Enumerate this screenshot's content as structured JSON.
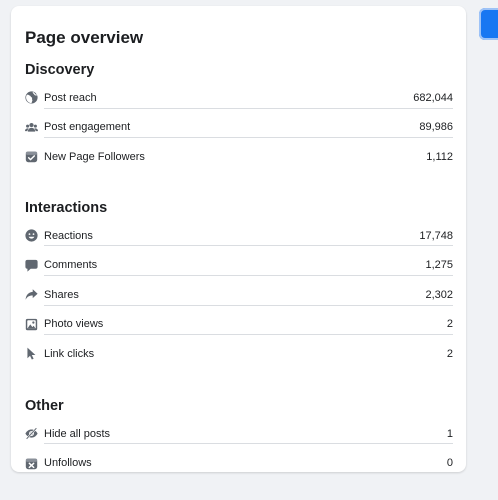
{
  "title": "Page overview",
  "colors": {
    "accent": "#1877f2",
    "icon": "#606770",
    "text": "#1c1e21",
    "divider": "#dadde1"
  },
  "discovery": {
    "heading": "Discovery",
    "rows": [
      {
        "icon": "globe-icon",
        "label": "Post reach",
        "value": "682,044"
      },
      {
        "icon": "people-icon",
        "label": "Post engagement",
        "value": "89,986"
      },
      {
        "icon": "follow-check-icon",
        "label": "New Page Followers",
        "value": "1,112"
      }
    ]
  },
  "interactions": {
    "heading": "Interactions",
    "rows": [
      {
        "icon": "smiley-icon",
        "label": "Reactions",
        "value": "17,748"
      },
      {
        "icon": "comment-icon",
        "label": "Comments",
        "value": "1,275"
      },
      {
        "icon": "share-arrow-icon",
        "label": "Shares",
        "value": "2,302"
      },
      {
        "icon": "photo-icon",
        "label": "Photo views",
        "value": "2"
      },
      {
        "icon": "cursor-icon",
        "label": "Link clicks",
        "value": "2"
      }
    ]
  },
  "other": {
    "heading": "Other",
    "rows": [
      {
        "icon": "eye-hide-icon",
        "label": "Hide all posts",
        "value": "1"
      },
      {
        "icon": "unfollow-icon",
        "label": "Unfollows",
        "value": "0"
      }
    ]
  }
}
